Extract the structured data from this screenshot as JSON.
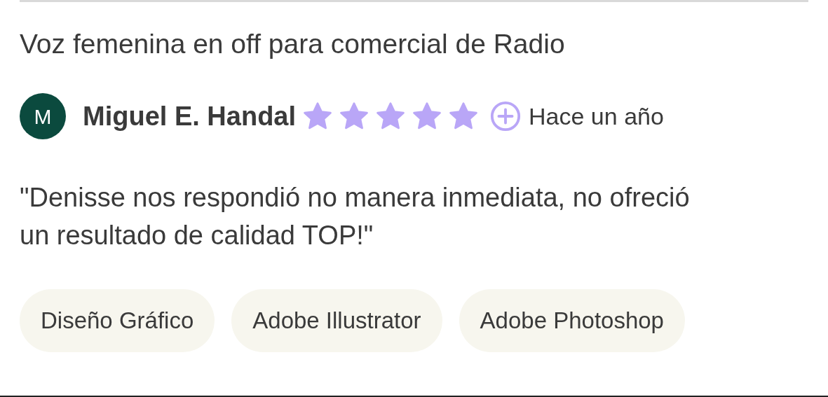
{
  "review": {
    "title": "Voz femenina en off para comercial de Radio",
    "author": {
      "initial": "M",
      "name": "Miguel E. Handal"
    },
    "rating": {
      "stars": 5
    },
    "time": "Hace un año",
    "quote": "\"Denisse nos respondió no manera inmediata, no ofreció un resultado de calidad TOP!\"",
    "tags": [
      {
        "label": "Diseño Gráfico"
      },
      {
        "label": "Adobe Illustrator"
      },
      {
        "label": "Adobe Photoshop"
      }
    ]
  }
}
